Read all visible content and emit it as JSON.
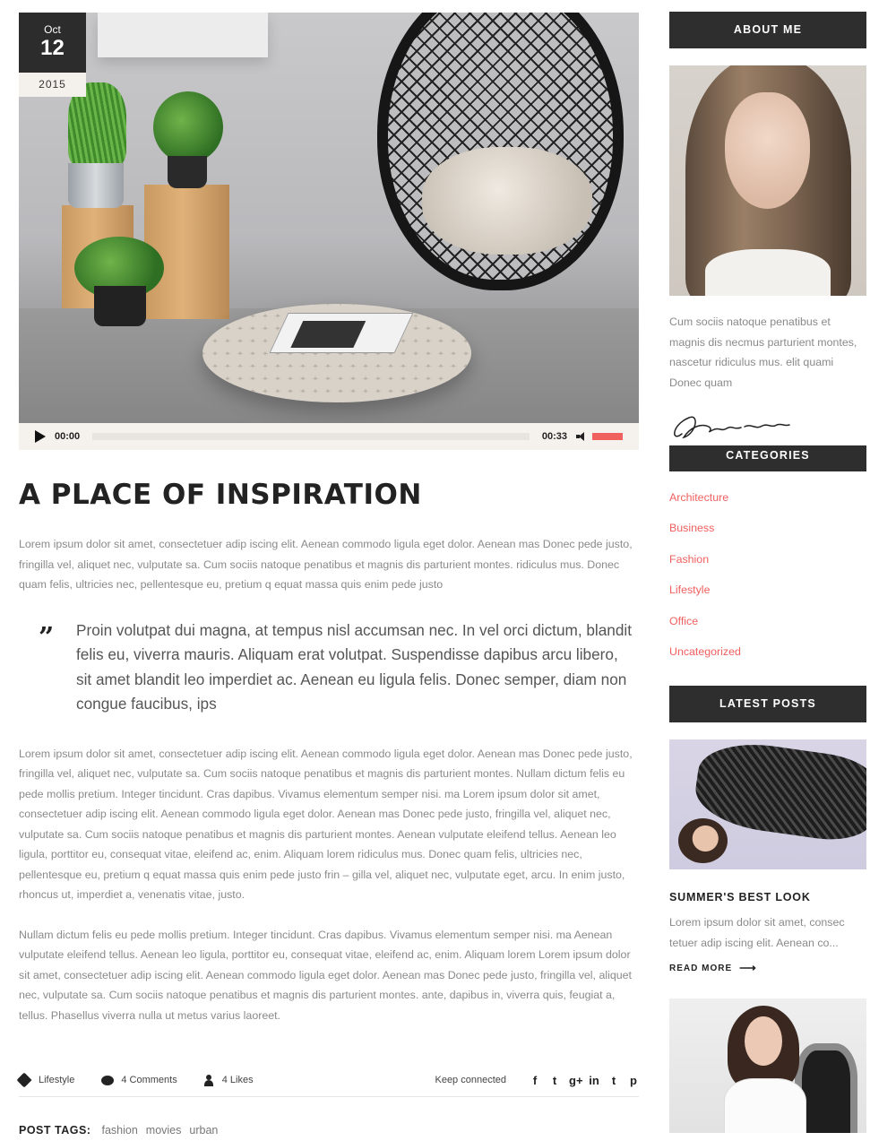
{
  "post": {
    "date": {
      "month": "Oct",
      "day": "12",
      "year": "2015"
    },
    "audio": {
      "current_time": "00:00",
      "duration": "00:33",
      "progress": 0,
      "volume": 1.0
    },
    "title": "A PLACE OF INSPIRATION",
    "intro": "Lorem ipsum dolor sit amet, consectetuer adip iscing elit. Aenean commodo ligula eget dolor. Aenean mas Donec pede justo, fringilla vel, aliquet nec, vulputate sa. Cum sociis natoque penatibus et magnis dis parturient montes. ridiculus mus. Donec quam felis, ultricies nec, pellentesque eu, pretium q equat massa quis enim pede justo",
    "quote_mark": "”",
    "quote": "Proin volutpat dui magna, at tempus nisl accumsan nec. In vel orci dictum, blandit felis eu, viverra mauris. Aliquam erat volutpat. Suspendisse dapibus arcu libero, sit amet blandit leo imperdiet ac. Aenean eu ligula felis. Donec semper, diam non congue faucibus, ips",
    "body_1": "Lorem ipsum dolor sit amet, consectetuer adip iscing elit. Aenean commodo ligula eget dolor. Aenean mas Donec pede justo, fringilla vel, aliquet nec, vulputate sa. Cum sociis natoque penatibus et magnis dis parturient montes. Nullam dictum felis eu pede mollis pretium. Integer tincidunt. Cras dapibus. Vivamus elementum semper nisi. ma Lorem ipsum dolor sit amet, consectetuer adip iscing elit. Aenean commodo ligula eget dolor. Aenean mas Donec pede justo, fringilla vel, aliquet nec, vulputate sa. Cum sociis natoque penatibus et magnis dis parturient montes. Aenean vulputate eleifend tellus. Aenean leo ligula, porttitor eu, consequat vitae, eleifend ac, enim. Aliquam lorem ridiculus mus. Donec quam felis, ultricies nec, pellentesque eu, pretium q equat massa quis enim pede justo frin – gilla vel, aliquet nec, vulputate eget, arcu. In enim justo, rhoncus ut, imperdiet a, venenatis vitae, justo.",
    "body_2": "Nullam dictum felis eu pede mollis pretium. Integer tincidunt. Cras dapibus. Vivamus elementum semper nisi. ma Aenean vulputate eleifend tellus. Aenean leo ligula, porttitor eu, consequat vitae, eleifend ac, enim. Aliquam lorem Lorem ipsum dolor sit amet, consectetuer adip iscing elit. Aenean commodo ligula eget dolor. Aenean mas Donec pede justo, fringilla vel, aliquet nec, vulputate sa. Cum sociis natoque penatibus et magnis dis parturient montes. ante, dapibus in, viverra quis, feugiat a, tellus. Phasellus viverra nulla ut metus varius laoreet.",
    "meta": {
      "category": "Lifestyle",
      "comments": "4 Comments",
      "likes": "4 Likes",
      "keep_connected": "Keep connected",
      "social": [
        "f",
        "t",
        "g+",
        "in",
        "t",
        "p"
      ]
    },
    "tags_label": "POST TAGS:",
    "tags": [
      "fashion",
      "movies",
      "urban"
    ]
  },
  "sidebar": {
    "about_title": "ABOUT ME",
    "about_text": "Cum sociis natoque penatibus et magnis dis necmus parturient montes, nascetur ridiculus mus. elit quami Donec quam",
    "categories_title": "CATEGORIES",
    "categories": [
      "Architecture",
      "Business",
      "Fashion",
      "Lifestyle",
      "Office",
      "Uncategorized"
    ],
    "latest_title": "LATEST POSTS",
    "latest_posts": [
      {
        "title": "SUMMER'S BEST LOOK",
        "excerpt": "Lorem ipsum dolor sit amet, consec tetuer adip iscing elit. Aenean co...",
        "read_more": "READ MORE"
      }
    ]
  },
  "colors": {
    "accent": "#f0605f",
    "dark": "#2e2e2e",
    "text": "#8a8a8a",
    "heading": "#222222",
    "player_bg": "#f5f1ed"
  }
}
